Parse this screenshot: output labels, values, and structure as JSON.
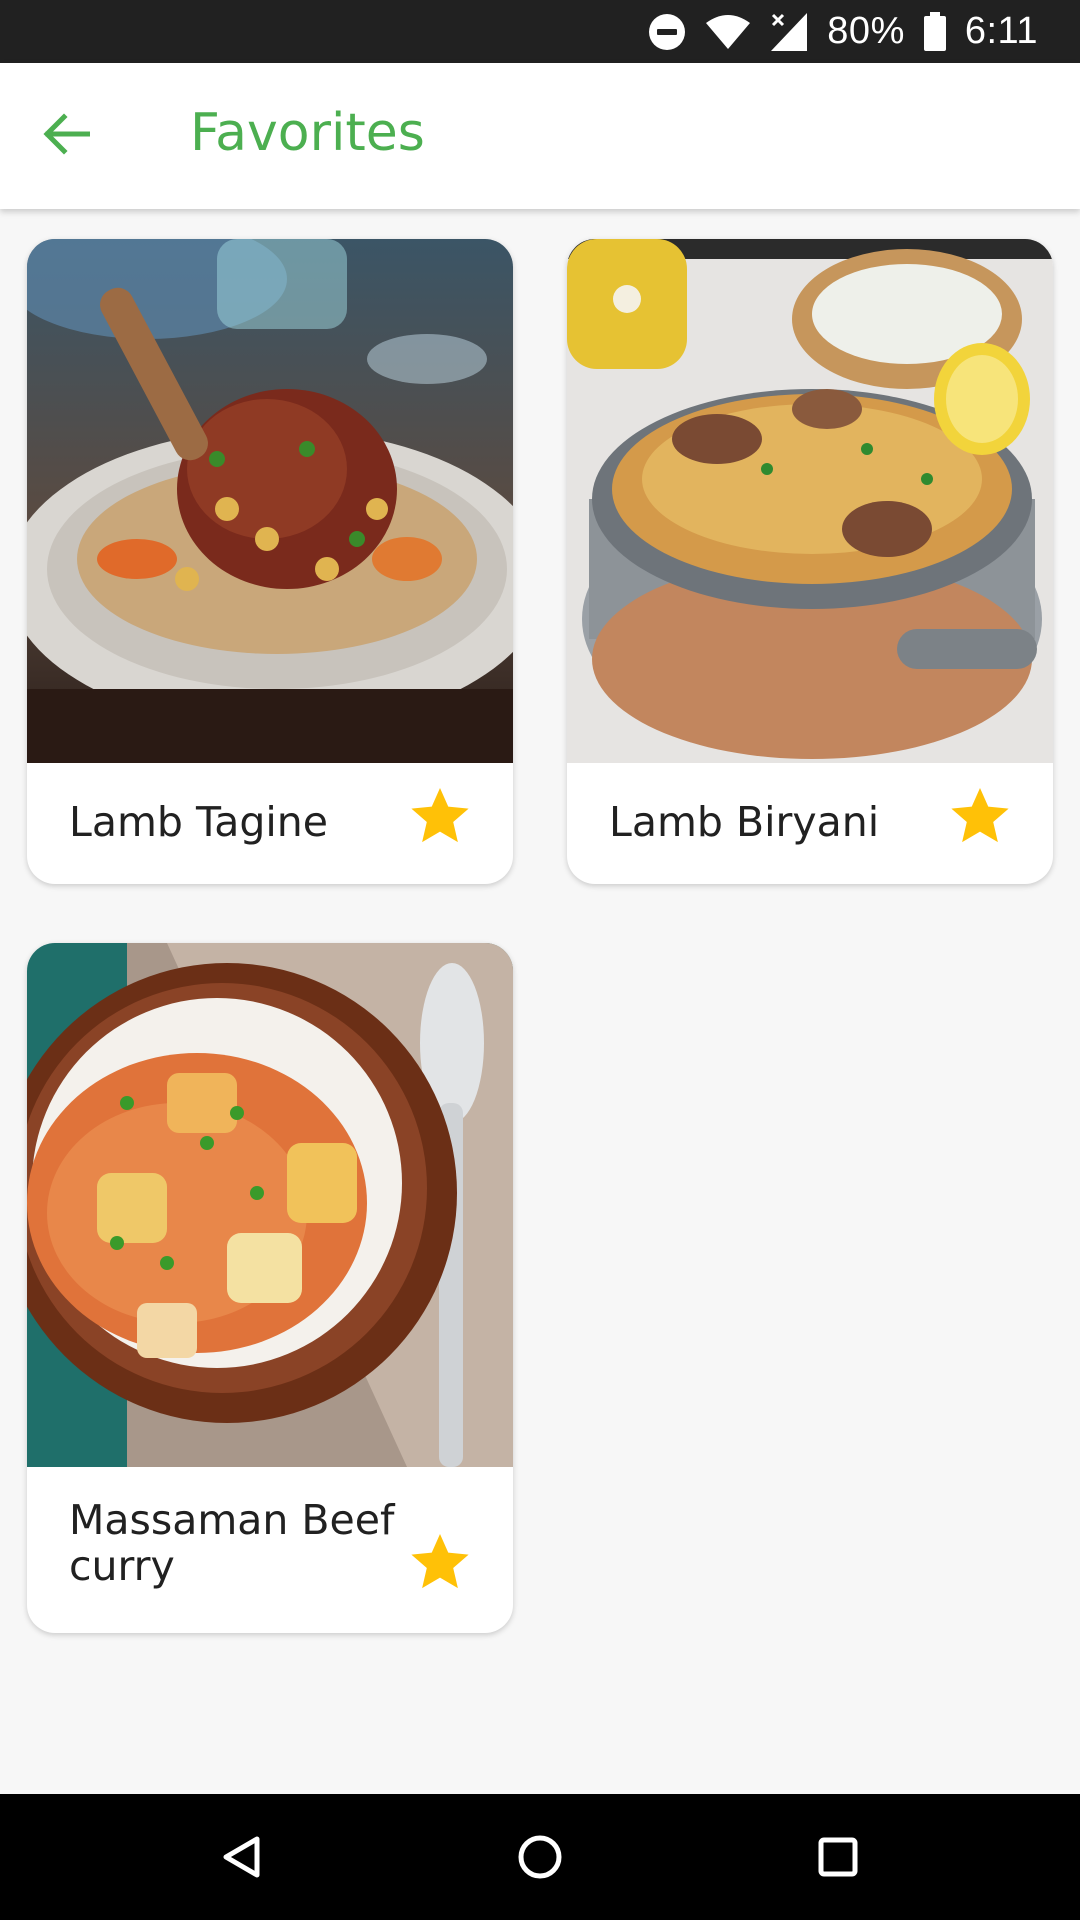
{
  "status_bar": {
    "battery": "80%",
    "time": "6:11",
    "icons": [
      "do-not-disturb-icon",
      "wifi-icon",
      "cellular-no-data-icon",
      "battery-icon"
    ]
  },
  "app_bar": {
    "back_icon": "arrow-back-icon",
    "title": "Favorites",
    "accent_color": "#4caf50"
  },
  "favorites": [
    {
      "name": "Lamb Tagine",
      "favorited": true,
      "image": "lamb tagine dish photo"
    },
    {
      "name": "Lamb Biryani",
      "favorited": true,
      "image": "lamb biryani pot photo"
    },
    {
      "name": "Massaman Beef curry",
      "favorited": true,
      "image": "massaman curry bowl photo"
    }
  ],
  "star_color": "#ffc107",
  "nav_bar": {
    "icons": [
      "back-triangle-icon",
      "home-circle-icon",
      "recents-square-icon"
    ]
  }
}
